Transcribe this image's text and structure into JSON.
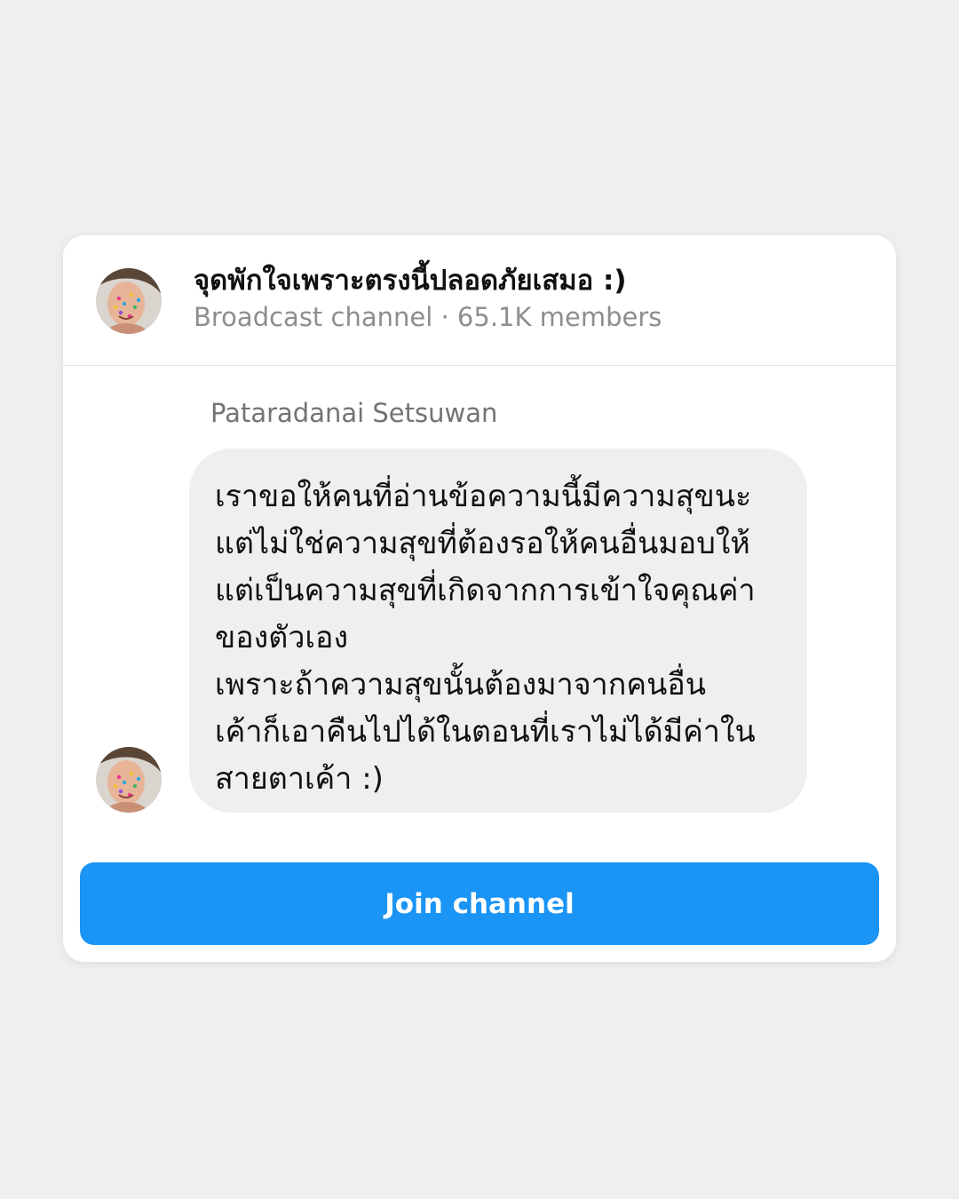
{
  "channel": {
    "title": "จุดพักใจเพราะตรงนี้ปลอดภัยเสมอ :)",
    "subtitle": "Broadcast channel · 65.1K members",
    "avatar_icon": "profile-photo"
  },
  "message": {
    "sender": "Pataradanai Setsuwan",
    "lines": [
      "เราขอให้คนที่อ่านข้อความนี้มีความสุขนะ",
      "แต่ไม่ใช่ความสุขที่ต้องรอให้คนอื่นมอบให้",
      "แต่เป็นความสุขที่เกิดจากการเข้าใจคุณค่า",
      "ของตัวเอง",
      "เพราะถ้าความสุขนั้นต้องมาจากคนอื่น",
      "เค้าก็เอาคืนไปได้ในตอนที่เราไม่ได้มีค่าใน",
      "สายตาเค้า :)"
    ]
  },
  "actions": {
    "join_label": "Join channel"
  },
  "colors": {
    "accent": "#1a94f5",
    "bubble": "#efefef",
    "background": "#efefef"
  }
}
